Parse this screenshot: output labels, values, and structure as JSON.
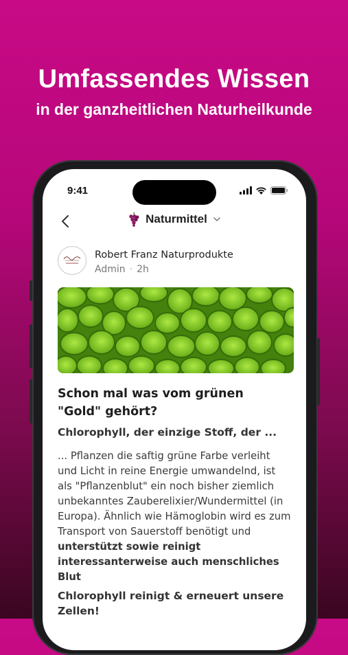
{
  "headline": {
    "title": "Umfassendes Wissen",
    "subtitle": "in der ganzheitlichen Naturheilkunde"
  },
  "status_bar": {
    "time": "9:41",
    "icons": [
      "cellular-signal-icon",
      "wifi-icon",
      "battery-icon"
    ]
  },
  "nav": {
    "back_icon": "chevron-left-icon",
    "group_icon": "grapes-icon",
    "title": "Naturmittel",
    "dropdown_icon": "chevron-down-icon"
  },
  "post": {
    "author": "Robert Franz Naturprodukte",
    "role": "Admin",
    "separator": "·",
    "time_ago": "2h",
    "title": "Schon mal was vom grünen \"Gold\" gehört?",
    "subtitle": "Chlorophyll, der einzige Stoff, der ...",
    "body_plain": "... Pflanzen die saftig grüne Farbe verleiht und Licht in reine Energie umwandelnd, ist als \"Pflanzenblut\" ein noch bisher ziemlich unbekanntes Zauberelixier/Wundermittel (in Europa). Ähnlich wie Hämoglobin wird es zum Transport von Sauerstoff benötigt und ",
    "body_bold": "unterstützt sowie reinigt interessanterweise auch menschliches Blut",
    "section_heading": "Chlorophyll reinigt & erneuert unsere Zellen!"
  },
  "colors": {
    "background_top": "#c80a86",
    "background_bottom": "#3a0620",
    "accent_grape": "#8a1a63",
    "cover_green": "#7ec41f"
  }
}
